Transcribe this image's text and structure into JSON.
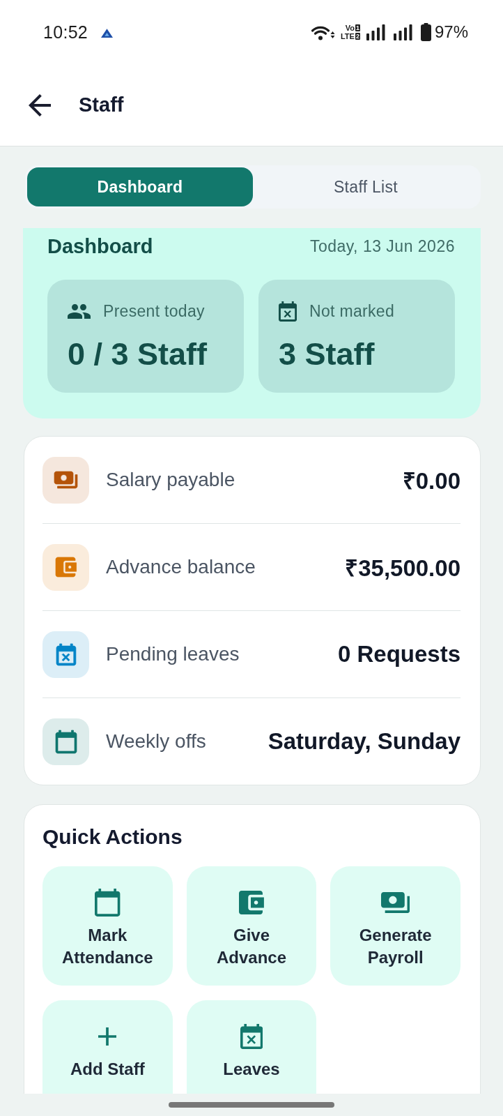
{
  "status_bar": {
    "time": "10:52",
    "network": [
      {
        "text": "Vo",
        "slot": "1"
      },
      {
        "text": "LTE",
        "slot": "2"
      }
    ],
    "battery": "97%"
  },
  "app_bar": {
    "title": "Staff"
  },
  "tabs": [
    {
      "label": "Dashboard",
      "selected": true
    },
    {
      "label": "Staff List",
      "selected": false
    }
  ],
  "dashboard": {
    "title": "Dashboard",
    "date": "Today, 13 Jun 2026",
    "stats": [
      {
        "kind": "people",
        "label": "Present today",
        "value": "0 / 3 Staff"
      },
      {
        "kind": "leave",
        "label": "Not marked",
        "value": "3 Staff"
      }
    ]
  },
  "summary": [
    {
      "kind": "cash",
      "color": "#b45309",
      "label": "Salary payable",
      "value": "₹0.00"
    },
    {
      "kind": "wallet",
      "color": "#d97706",
      "label": "Advance balance",
      "value": "₹35,500.00"
    },
    {
      "kind": "leave",
      "color": "#0284c7",
      "label": "Pending leaves",
      "value": "0 Requests"
    },
    {
      "kind": "calendar",
      "color": "#0f766e",
      "label": "Weekly offs",
      "value": "Saturday, Sunday"
    }
  ],
  "quick_actions": {
    "title": "Quick Actions",
    "items": [
      {
        "kind": "calendar",
        "label": "Mark\nAttendance"
      },
      {
        "kind": "wallet",
        "label": "Give\nAdvance"
      },
      {
        "kind": "cash",
        "label": "Generate\nPayroll"
      },
      {
        "kind": "add",
        "label": "Add Staff"
      },
      {
        "kind": "leave",
        "label": "Leaves"
      }
    ]
  }
}
